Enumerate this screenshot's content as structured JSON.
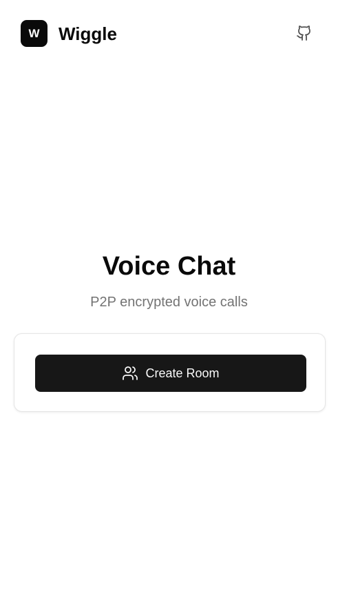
{
  "header": {
    "logo_letter": "W",
    "app_name": "Wiggle",
    "github_icon": "github-icon"
  },
  "hero": {
    "title": "Voice Chat",
    "subtitle": "P2P encrypted voice calls"
  },
  "card": {
    "create_button_label": "Create Room",
    "create_button_icon": "users-icon"
  },
  "colors": {
    "primary": "#171717",
    "text": "#0a0a0a",
    "muted": "#737373",
    "border": "#e5e5e5",
    "background": "#ffffff"
  }
}
